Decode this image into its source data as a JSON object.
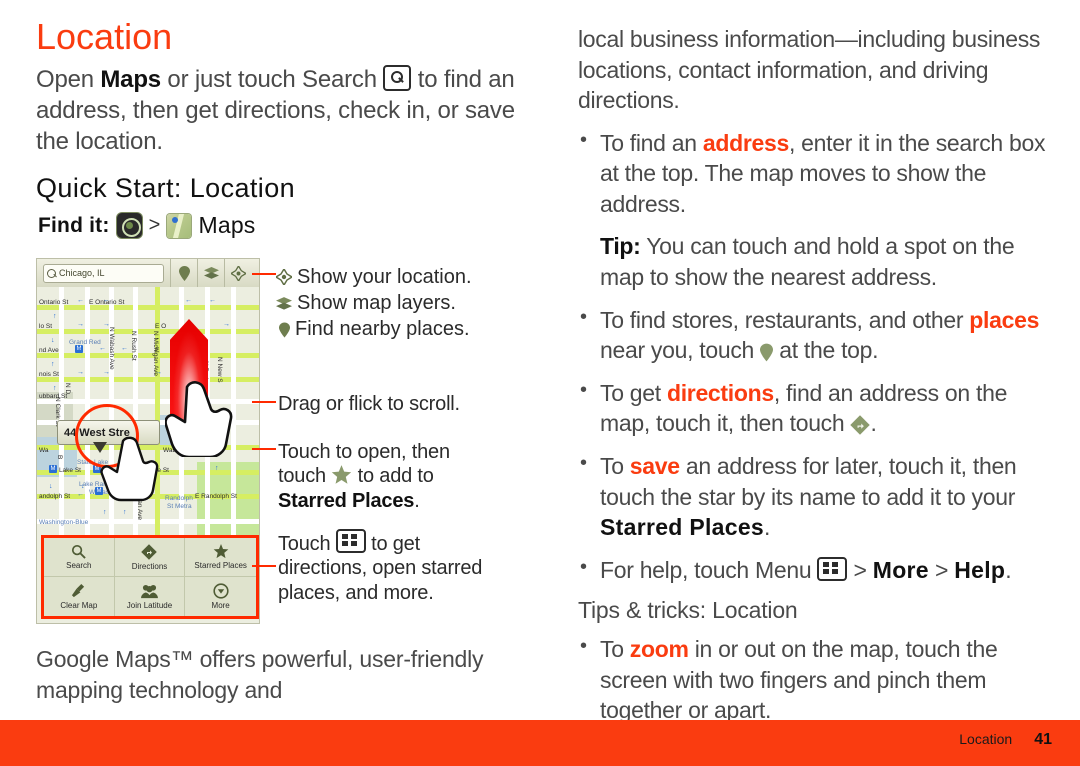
{
  "page": {
    "title": "Location",
    "intro_pre": "Open ",
    "intro_bold": "Maps",
    "intro_mid": " or just touch Search ",
    "intro_post": " to find an address, then get directions, check in, or save the location.",
    "section_title": "Quick Start: Location",
    "find_it_label": "Find it:",
    "find_it_sep": ">",
    "find_it_app": "Maps",
    "closing_text": "Google Maps™ offers powerful, user-friendly mapping technology and"
  },
  "phone": {
    "search_value": "Chicago, IL",
    "address_bubble": "44 West Stre",
    "map_labels": [
      "Ontario St",
      "E Ontario St",
      "io St",
      "nd Ave",
      "nois St",
      "ubbard St",
      "N Wabash Ave",
      "N Rush St",
      "N Michigan Ave",
      "N New S",
      "N Park",
      "N Clark St",
      "N D",
      "E O",
      "E",
      "Grand Red",
      "Wa",
      "Waba St",
      "W Lake St",
      "W Lake St",
      "State Lake",
      "Lake  Randolph Wabash",
      "andolph St",
      "E Randolph St",
      "Randolph St Metra",
      "Washington-Blue",
      "N Michigan Ave",
      "B"
    ],
    "menu": [
      {
        "label": "Search",
        "icon": "search-icon"
      },
      {
        "label": "Directions",
        "icon": "directions-icon"
      },
      {
        "label": "Starred Places",
        "icon": "star-icon"
      },
      {
        "label": "Clear Map",
        "icon": "broom-icon"
      },
      {
        "label": "Join Latitude",
        "icon": "people-icon"
      },
      {
        "label": "More",
        "icon": "chevron-down-circle-icon"
      }
    ]
  },
  "callouts": {
    "show_location": "Show your location.",
    "show_layers": "Show map layers.",
    "find_places": "Find nearby places.",
    "drag": "Drag or flick to scroll.",
    "touch_open_1": "Touch to open, then",
    "touch_open_2a": "touch ",
    "touch_open_2b": " to add to",
    "touch_open_3": "Starred Places",
    "touch_open_3_end": ".",
    "touch_menu_1a": "Touch ",
    "touch_menu_1b": " to get",
    "touch_menu_2": "directions, open starred",
    "touch_menu_3": "places, and more."
  },
  "right_column": {
    "continuation": "local business information—including business locations, contact information, and driving directions.",
    "bullets": [
      {
        "id": "address",
        "pre": "To find an ",
        "hi": "address",
        "post": ", enter it in the search box at the top. The map moves to show the address."
      },
      {
        "id": "tip",
        "bold": "Tip:",
        "post": " You can touch and hold a spot on the map to show the nearest address."
      },
      {
        "id": "places",
        "pre": "To find stores, restaurants, and other ",
        "hi": "places",
        "mid": " near you, touch ",
        "post": " at the top."
      },
      {
        "id": "directions",
        "pre": "To get ",
        "hi": "directions",
        "mid": ", find an address on the map, touch it, then touch ",
        "post": "."
      },
      {
        "id": "save",
        "pre": "To ",
        "hi": "save",
        "mid": " an address for later, touch it, then touch the star by its name to add it to your ",
        "ui": "Starred Places",
        "post": "."
      },
      {
        "id": "help",
        "pre": "For help, touch Menu ",
        "mid": " > ",
        "ui": "More",
        "mid2": " > ",
        "ui2": "Help",
        "post": "."
      }
    ],
    "tips_title": "Tips & tricks: Location",
    "tips_bullets": [
      {
        "id": "zoom",
        "pre": "To ",
        "hi": "zoom",
        "post": " in or out on the map, touch the screen with two fingers and pinch them together or apart."
      }
    ]
  },
  "footer": {
    "chapter": "Location",
    "page_number": "41"
  },
  "colors": {
    "accent_orange": "#fa3c10",
    "body_gray": "#4a4a4a",
    "callout_red": "#ff2a00",
    "map_green": "#d6ee62"
  }
}
